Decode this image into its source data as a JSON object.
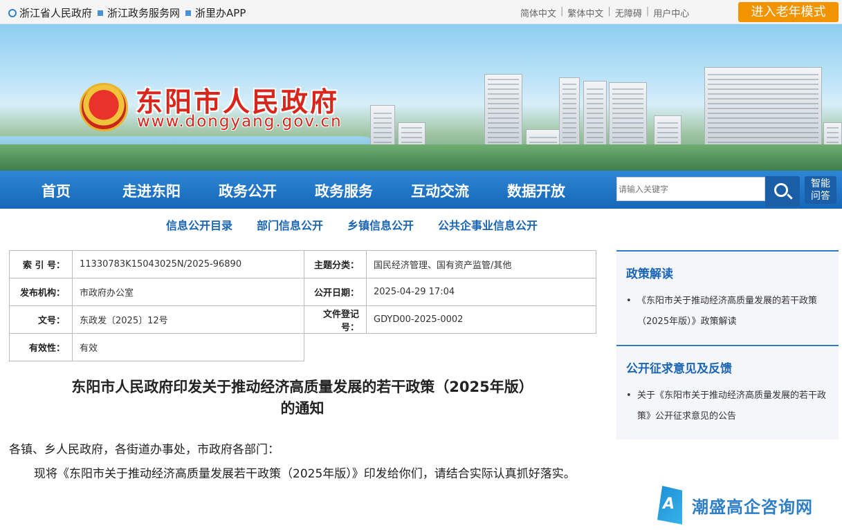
{
  "topbar": {
    "links": [
      "浙江省人民政府",
      "浙江政务服务网",
      "浙里办APP"
    ],
    "right_links": [
      "简体中文",
      "繁体中文",
      "无障碍",
      "用户中心"
    ],
    "separator": "|",
    "elder_mode": "进入老年模式"
  },
  "banner": {
    "site_name": "东阳市人民政府",
    "site_url": "www.dongyang.gov.cn"
  },
  "nav": {
    "items": [
      "首页",
      "走进东阳",
      "政务公开",
      "政务服务",
      "互动交流",
      "数据开放"
    ],
    "search_placeholder": "请输入关键字",
    "smart_qa": "智能问答"
  },
  "subnav": [
    "信息公开目录",
    "部门信息公开",
    "乡镇信息公开",
    "公共企事业信息公开"
  ],
  "info": {
    "index_label": "索 引 号：",
    "index_value": "11330783K15043025N/2025-96890",
    "category_label": "主题分类：",
    "category_value": "国民经济管理、国有资产监管/其他",
    "org_label": "发布机构：",
    "org_value": "市政府办公室",
    "date_label": "公开日期：",
    "date_value": "2025-04-29 17:04",
    "doc_label": "文号：",
    "doc_value": "东政发〔2025〕12号",
    "reg_label": "文件登记号：",
    "reg_value": "GDYD00-2025-0002",
    "valid_label": "有效性：",
    "valid_value": "有效"
  },
  "article": {
    "title_line1": "东阳市人民政府印发关于推动经济高质量发展的若干政策（2025年版）",
    "title_line2": "的通知",
    "greeting": "各镇、乡人民政府，各街道办事处，市政府各部门：",
    "body": "现将《东阳市关于推动经济高质量发展若干政策（2025年版）》印发给你们，请结合实际认真抓好落实。"
  },
  "sidebar": {
    "policy_title": "政策解读",
    "policy_items": [
      "《东阳市关于推动经济高质量发展的若干政策（2025年版）》政策解读"
    ],
    "feedback_title": "公开征求意见及反馈",
    "feedback_items": [
      "关于《东阳市关于推动经济高质量发展的若干政策》公开征求意见的公告"
    ]
  },
  "watermark": {
    "logo_letter": "A",
    "text": "潮盛高企咨询网"
  },
  "colors": {
    "nav_blue": "#1667b8",
    "accent_orange": "#f29400",
    "title_red": "#d9261c"
  }
}
